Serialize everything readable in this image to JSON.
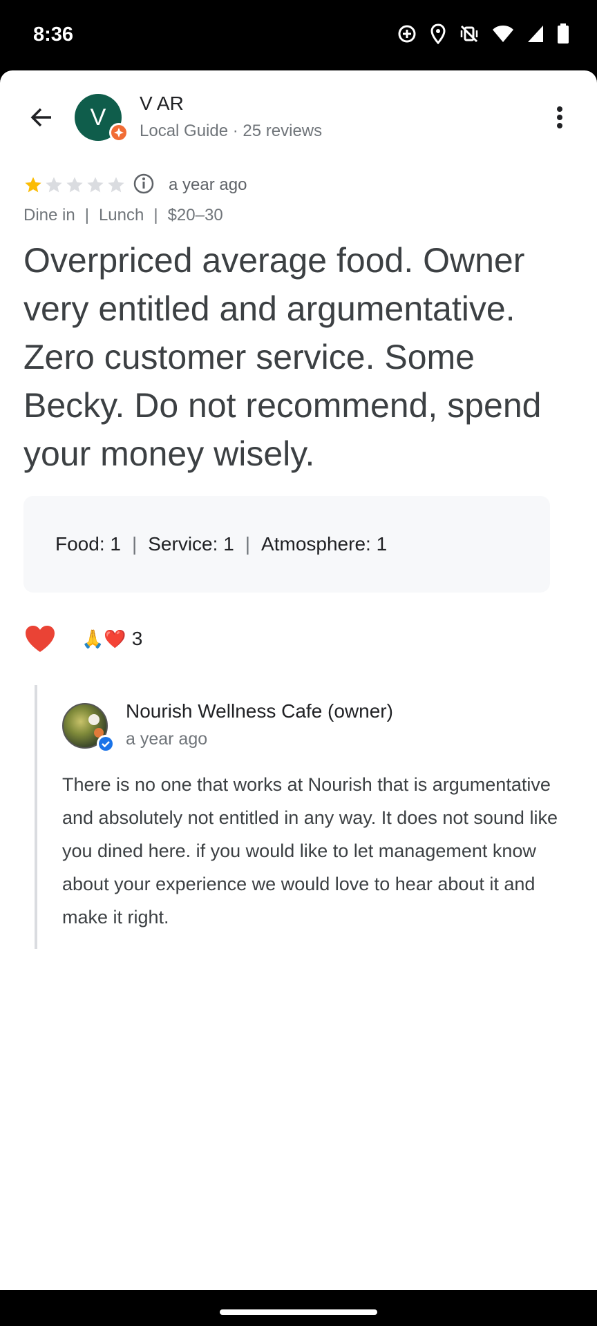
{
  "status_bar": {
    "time": "8:36"
  },
  "reviewer": {
    "initial": "V",
    "name": "V AR",
    "meta": "Local Guide · 25 reviews"
  },
  "review": {
    "rating": 1,
    "max_rating": 5,
    "time_ago": "a year ago",
    "tags": [
      "Dine in",
      "Lunch",
      "$20–30"
    ],
    "text": "Overpriced average food. Owner very entitled and argumentative. Zero customer service. Some Becky. Do not recommend, spend your money wisely.",
    "sub_ratings": [
      {
        "label": "Food:",
        "value": "1"
      },
      {
        "label": "Service:",
        "value": "1"
      },
      {
        "label": "Atmosphere:",
        "value": "1"
      }
    ],
    "reactions": {
      "emojis": [
        "🙏",
        "❤️"
      ],
      "count": "3"
    }
  },
  "owner_reply": {
    "name": "Nourish Wellness Cafe (owner)",
    "time_ago": "a year ago",
    "text": "There is no one that works at Nourish that is argumentative and absolutely not entitled in any way. It does not sound like you dined here. if you would like to let management know about your experience we would love to hear about it and make it right."
  },
  "colors": {
    "star_filled": "#fbbc04",
    "star_empty": "#dadce0",
    "avatar_bg": "#0f5d4b",
    "guide_badge": "#f16c35",
    "verified": "#1a73e8",
    "heart": "#ea4335"
  }
}
